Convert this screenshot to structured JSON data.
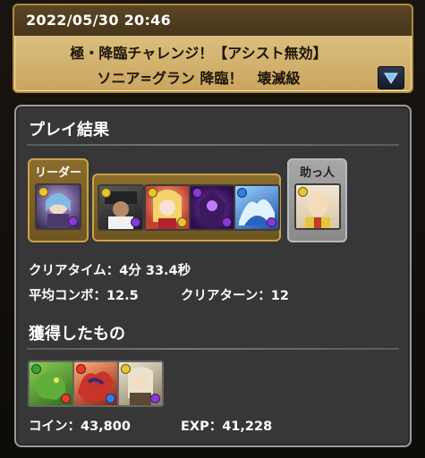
{
  "header": {
    "date": "2022/05/30 20:46",
    "title": "極・降臨チャレンジ！【アシスト無効】",
    "subtitle": "ソニア=グラン 降臨！　壊滅級",
    "expand_icon": "triangle-down-icon"
  },
  "result": {
    "title": "プレイ結果",
    "leader_label": "リーダー",
    "helper_label": "助っ人",
    "clear_time_label": "クリアタイム：",
    "clear_time_value": "4分 33.4秒",
    "avg_combo_label": "平均コンボ：",
    "avg_combo_value": "12.5",
    "clear_turn_label": "クリアターン：",
    "clear_turn_value": "12"
  },
  "acquired": {
    "title": "獲得したもの",
    "coin_label": "コイン：",
    "coin_value": "43,800",
    "exp_label": "EXP：",
    "exp_value": "41,228"
  },
  "colors": {
    "fire": "#e23b2f",
    "water": "#2f7fe2",
    "wood": "#3aa23a",
    "light": "#e8c531",
    "dark": "#8a3ad6"
  }
}
